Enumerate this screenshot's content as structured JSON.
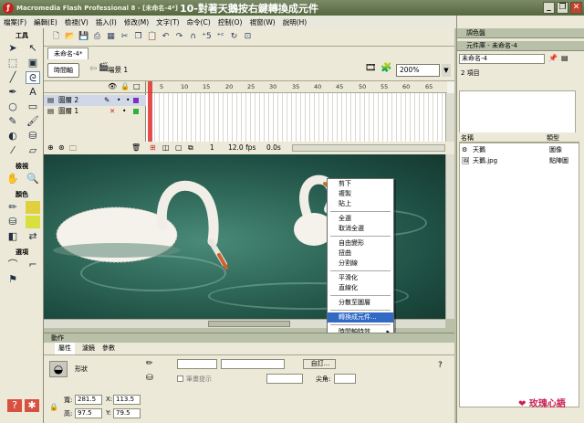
{
  "window": {
    "app_title": "Macromedia Flash Professional 8 - [未命名-4*]",
    "overlay_title": "10-對著天鵝按右鍵轉換成元件",
    "app_icon_glyph": "ƒ"
  },
  "menubar": [
    "檔案(F)",
    "編輯(E)",
    "檢視(V)",
    "插入(I)",
    "修改(M)",
    "文字(T)",
    "命令(C)",
    "控制(O)",
    "視窗(W)",
    "說明(H)"
  ],
  "tools": {
    "header_tools": "工具",
    "header_view": "檢視",
    "header_colors": "顏色",
    "header_options": "選項"
  },
  "document": {
    "tab": "未命名-4*",
    "timeline_button": "時間軸",
    "scene": "場景 1",
    "zoom": "200%"
  },
  "timeline": {
    "layers": [
      "圖層 2",
      "圖層 1"
    ],
    "frame_numbers": [
      "5",
      "10",
      "15",
      "20",
      "25",
      "30",
      "35",
      "40",
      "45",
      "50",
      "55",
      "60",
      "65"
    ],
    "current_frame": "1",
    "fps": "12.0 fps",
    "time": "0.0s"
  },
  "context_menu": {
    "groups": [
      [
        "剪下",
        "複製",
        "貼上"
      ],
      [
        "全選",
        "取消全選"
      ],
      [
        "自由變形",
        "扭曲",
        "分割線"
      ],
      [
        "平滑化",
        "直線化"
      ],
      [
        "分散至圖層"
      ],
      [
        "轉換成元件..."
      ],
      [
        "時間軸特效"
      ]
    ],
    "highlighted": "轉換成元件..."
  },
  "properties": {
    "panel_title": "動作",
    "tabs": [
      "屬性",
      "濾鏡",
      "參數"
    ],
    "shape_label": "形狀",
    "edit_button": "自訂...",
    "stroke_label": "筆畫提示",
    "cap_label": "尖角:",
    "w_label": "寬:",
    "w_value": "281.5",
    "x_label": "X:",
    "x_value": "113.5",
    "h_label": "高:",
    "h_value": "97.5",
    "y_label": "Y:",
    "y_value": "79.5"
  },
  "right_panel": {
    "color_panel": "調色盤",
    "library_panel": "元件庫 - 未命名-4",
    "library_select": "未命名-4",
    "item_count": "2 項目",
    "col_name": "名稱",
    "col_type": "類型",
    "items": [
      {
        "name": "天鵝",
        "type": "圖像"
      },
      {
        "name": "天鵝.jpg",
        "type": "點陣圖"
      }
    ]
  },
  "watermark": "❤ 玫瑰心語"
}
